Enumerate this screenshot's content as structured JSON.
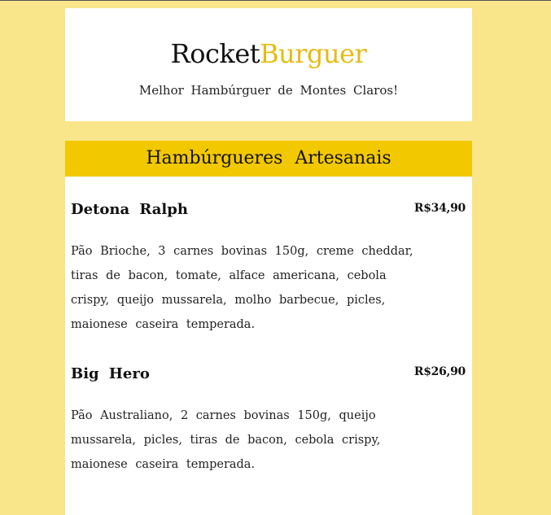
{
  "header": {
    "brand_part1": "Rocket",
    "brand_part2": "Burguer",
    "tagline": "Melhor Hambúrguer de Montes Claros!"
  },
  "menu": {
    "section_title": "Hambúrgueres Artesanais",
    "items": [
      {
        "name": "Detona Ralph",
        "price": "R$34,90",
        "description": "Pão Brioche, 3 carnes bovinas 150g, creme cheddar, tiras de bacon, tomate, alface americana, cebola crispy, queijo mussarela, molho barbecue, picles, maionese caseira temperada."
      },
      {
        "name": "Big Hero",
        "price": "R$26,90",
        "description": "Pão Australiano, 2 carnes bovinas 150g, queijo mussarela, picles, tiras de bacon, cebola crispy, maionese caseira temperada."
      }
    ]
  },
  "colors": {
    "background": "#f9e58a",
    "accent": "#f2c800",
    "brand_highlight": "#e7bb10"
  }
}
